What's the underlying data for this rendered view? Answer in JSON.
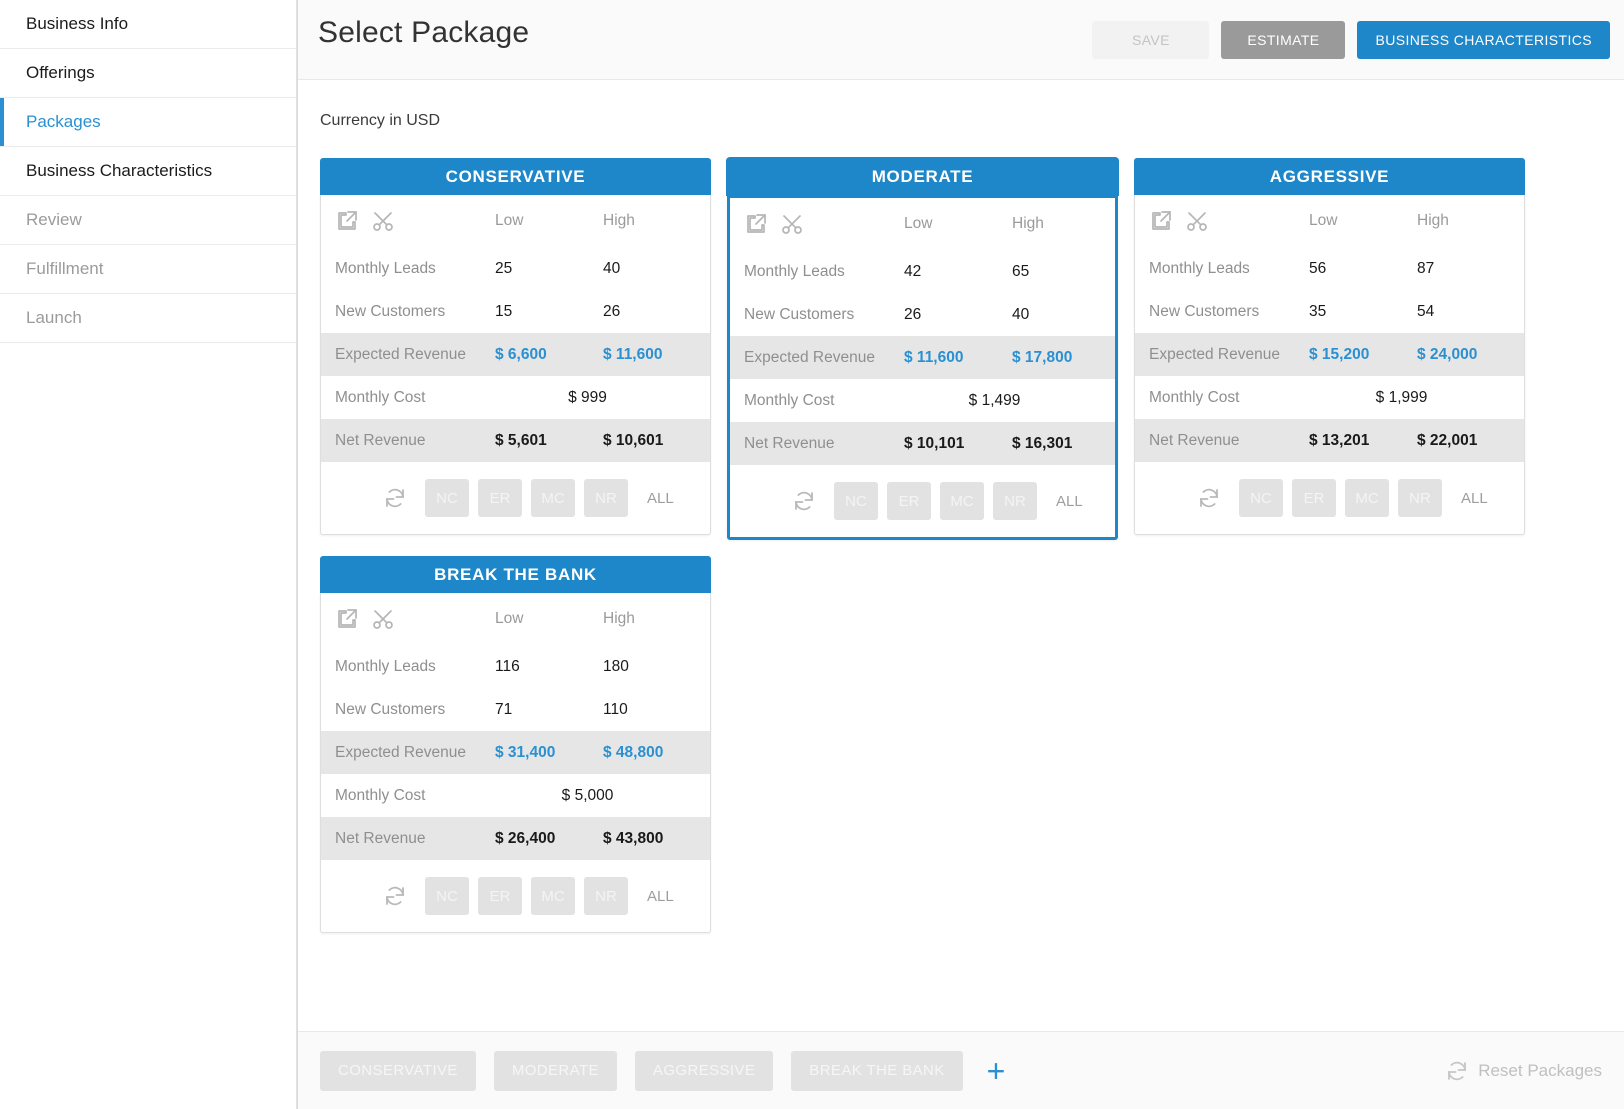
{
  "sidebar": {
    "items": [
      {
        "label": "Business Info",
        "state": "normal"
      },
      {
        "label": "Offerings",
        "state": "normal"
      },
      {
        "label": "Packages",
        "state": "active"
      },
      {
        "label": "Business Characteristics",
        "state": "normal"
      },
      {
        "label": "Review",
        "state": "muted"
      },
      {
        "label": "Fulfillment",
        "state": "muted"
      },
      {
        "label": "Launch",
        "state": "muted"
      }
    ]
  },
  "header": {
    "title": "Select Package",
    "save_label": "SAVE",
    "estimate_label": "ESTIMATE",
    "business_characteristics_label": "BUSINESS CHARACTERISTICS"
  },
  "content": {
    "currency_note": "Currency in USD",
    "column_low": "Low",
    "column_high": "High",
    "row_labels": {
      "monthly_leads": "Monthly Leads",
      "new_customers": "New Customers",
      "expected_revenue": "Expected Revenue",
      "monthly_cost": "Monthly Cost",
      "net_revenue": "Net Revenue"
    },
    "tag_buttons": [
      "NC",
      "ER",
      "MC",
      "NR"
    ],
    "all_label": "ALL"
  },
  "packages": [
    {
      "name": "CONSERVATIVE",
      "selected": false,
      "monthly_leads": {
        "low": "25",
        "high": "40"
      },
      "new_customers": {
        "low": "15",
        "high": "26"
      },
      "expected_revenue": {
        "low": "$ 6,600",
        "high": "$ 11,600"
      },
      "monthly_cost": "$ 999",
      "net_revenue": {
        "low": "$ 5,601",
        "high": "$ 10,601"
      }
    },
    {
      "name": "MODERATE",
      "selected": true,
      "monthly_leads": {
        "low": "42",
        "high": "65"
      },
      "new_customers": {
        "low": "26",
        "high": "40"
      },
      "expected_revenue": {
        "low": "$ 11,600",
        "high": "$ 17,800"
      },
      "monthly_cost": "$ 1,499",
      "net_revenue": {
        "low": "$ 10,101",
        "high": "$ 16,301"
      }
    },
    {
      "name": "AGGRESSIVE",
      "selected": false,
      "monthly_leads": {
        "low": "56",
        "high": "87"
      },
      "new_customers": {
        "low": "35",
        "high": "54"
      },
      "expected_revenue": {
        "low": "$ 15,200",
        "high": "$ 24,000"
      },
      "monthly_cost": "$ 1,999",
      "net_revenue": {
        "low": "$ 13,201",
        "high": "$ 22,001"
      }
    },
    {
      "name": "BREAK THE BANK",
      "selected": false,
      "monthly_leads": {
        "low": "116",
        "high": "180"
      },
      "new_customers": {
        "low": "71",
        "high": "110"
      },
      "expected_revenue": {
        "low": "$ 31,400",
        "high": "$ 48,800"
      },
      "monthly_cost": "$ 5,000",
      "net_revenue": {
        "low": "$ 26,400",
        "high": "$ 43,800"
      }
    }
  ],
  "bottombar": {
    "tabs": [
      "CONSERVATIVE",
      "MODERATE",
      "AGGRESSIVE",
      "BREAK THE BANK"
    ],
    "add_label": "+",
    "reset_label": "Reset Packages"
  },
  "colors": {
    "accent_blue": "#1d87c9",
    "link_blue": "#2a90d1",
    "estimate_gray": "#9a9a9a",
    "shaded_row": "#e6e6e6"
  }
}
